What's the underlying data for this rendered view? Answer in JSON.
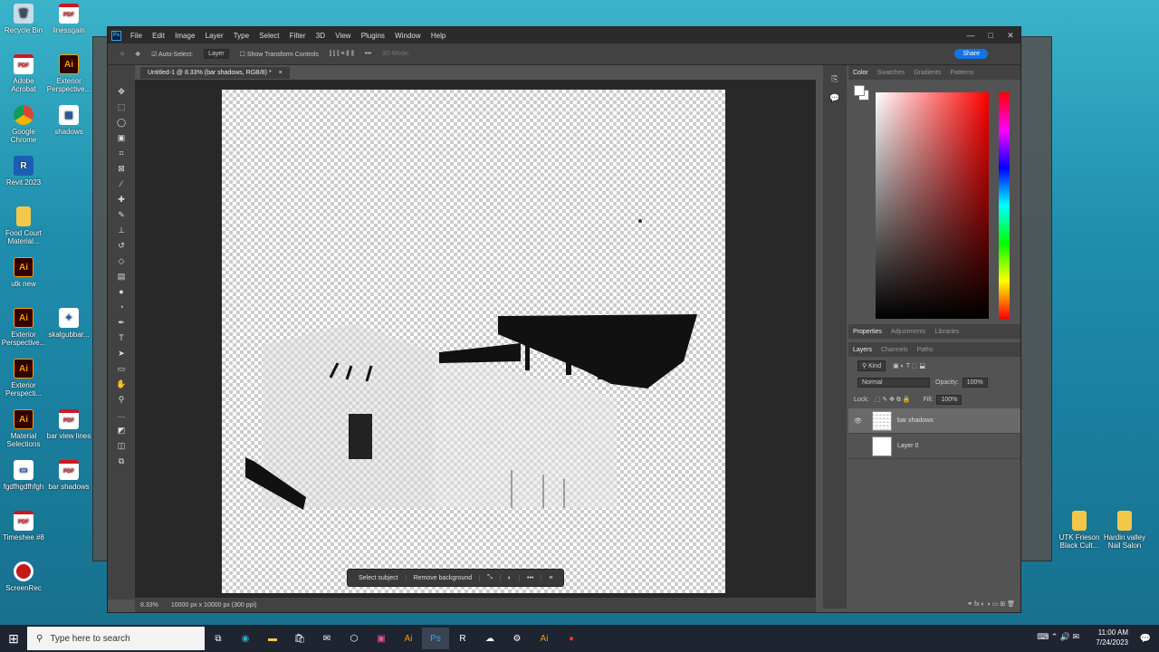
{
  "desktop_icons": [
    {
      "label": "Recycle Bin",
      "kind": "bin"
    },
    {
      "label": "linessgain",
      "kind": "pdf"
    },
    {
      "label": "Adobe Acrobat",
      "kind": "pdf"
    },
    {
      "label": "Exterior Perspective...",
      "kind": "ai"
    },
    {
      "label": "Google Chrome",
      "kind": "chrome"
    },
    {
      "label": "shadows",
      "kind": "doc"
    },
    {
      "label": "Revit 2023",
      "kind": "revit"
    },
    {
      "label": "Food Court Material...",
      "kind": "folder"
    },
    {
      "label": "utk new",
      "kind": "ai"
    },
    {
      "label": "Exterior Perspective...",
      "kind": "ai"
    },
    {
      "label": "skalgubbar...",
      "kind": "doc"
    },
    {
      "label": "Exterior Perspecti...",
      "kind": "ai"
    },
    {
      "label": "Material Selections",
      "kind": "ai"
    },
    {
      "label": "bar view lines",
      "kind": "pdf"
    },
    {
      "label": "fgdfhgdfhfgh",
      "kind": "doc"
    },
    {
      "label": "bar shadows",
      "kind": "pdf"
    },
    {
      "label": "Timeshee #8",
      "kind": "pdf"
    },
    {
      "label": "ScreenRec",
      "kind": "rec"
    },
    {
      "label": "UTK Frieson Black Cult...",
      "kind": "folder"
    },
    {
      "label": "Hardin valley Nail Salon",
      "kind": "folder"
    }
  ],
  "photoshop": {
    "logo": "Ps",
    "menu": [
      "File",
      "Edit",
      "Image",
      "Layer",
      "Type",
      "Select",
      "Filter",
      "3D",
      "View",
      "Plugins",
      "Window",
      "Help"
    ],
    "options": {
      "auto_select": "Auto-Select:",
      "layer_select": "Layer",
      "show_transform": "Show Transform Controls",
      "mode_3d": "3D Mode:",
      "share": "Share"
    },
    "tab_title": "Untitled-1 @ 8.33% (bar shadows, RGB/8) *",
    "context_bar": {
      "select_subject": "Select subject",
      "remove_background": "Remove background",
      "more": "•••"
    },
    "status": {
      "zoom": "8.33%",
      "dimensions": "10000 px x 10000 px (300 ppi)"
    },
    "color_panel": {
      "tabs": [
        "Color",
        "Swatches",
        "Gradients",
        "Patterns"
      ]
    },
    "properties_panel": {
      "tabs": [
        "Properties",
        "Adjustments",
        "Libraries"
      ]
    },
    "layers_panel": {
      "tabs": [
        "Layers",
        "Channels",
        "Paths"
      ],
      "kind": "Kind",
      "blend_mode": "Normal",
      "opacity_label": "Opacity:",
      "opacity": "100%",
      "lock_label": "Lock:",
      "fill_label": "Fill:",
      "fill": "100%",
      "layers": [
        {
          "name": "bar shadows",
          "visible": true,
          "active": true
        },
        {
          "name": "Layer 0",
          "visible": false,
          "active": false
        }
      ]
    }
  },
  "taskbar": {
    "search_placeholder": "Type here to search",
    "time": "11:00 AM",
    "date": "7/24/2023"
  },
  "colors": {
    "ps_bg": "#535353",
    "ps_dark": "#424242",
    "share_blue": "#1473e6",
    "taskbar": "#1e2430"
  }
}
